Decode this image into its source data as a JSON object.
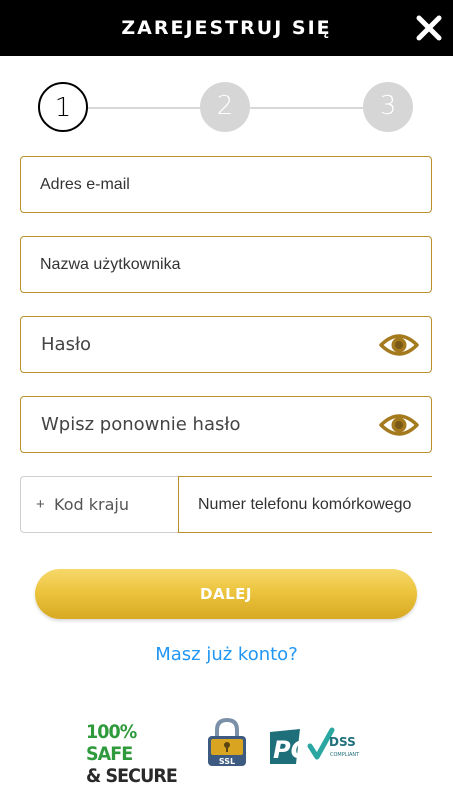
{
  "header": {
    "title": "ZAREJESTRUJ SIĘ"
  },
  "stepper": {
    "steps": [
      "1",
      "2",
      "3"
    ],
    "active_step": 1
  },
  "form": {
    "email": {
      "placeholder": "Adres e-mail"
    },
    "username": {
      "placeholder": "Nazwa użytkownika"
    },
    "password": {
      "placeholder": "Hasło"
    },
    "password_confirm": {
      "placeholder": "Wpisz ponownie hasło"
    },
    "country_code": {
      "prefix": "+",
      "placeholder": "Kod kraju"
    },
    "phone": {
      "placeholder": "Numer telefonu komórkowego"
    }
  },
  "buttons": {
    "next_label": "DALEJ"
  },
  "links": {
    "login": "Masz już konto?"
  },
  "badges": {
    "safe_line1": "100% SAFE",
    "safe_line2": "& SECURE",
    "ssl": "SSL",
    "pci": "PCI",
    "dss": "DSS",
    "compliant": "COMPLIANT"
  },
  "colors": {
    "header_bg": "#000000",
    "field_border": "#b8902a",
    "eye_icon": "#a57a1e",
    "button_gold": "#ecc43d",
    "link_blue": "#2196f3",
    "step_inactive": "#d6d6d6"
  },
  "icons": {
    "close": "close-icon",
    "password_eye": "eye-icon",
    "confirm_eye": "eye-icon",
    "ssl": "padlock-icon"
  }
}
